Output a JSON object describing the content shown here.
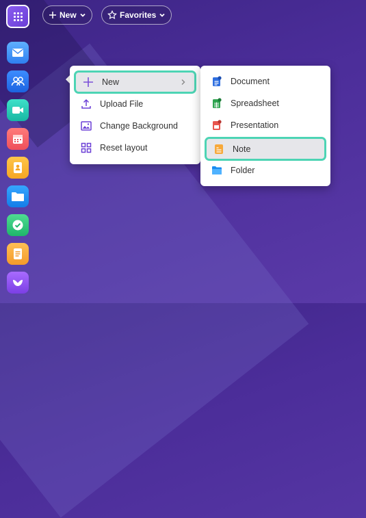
{
  "topbar": {
    "new_label": "New",
    "favorites_label": "Favorites"
  },
  "dock": [
    "mail-app",
    "contacts-app",
    "video-app",
    "calendar-app",
    "address-book-app",
    "files-app",
    "tasks-app",
    "notes-app",
    "other-app"
  ],
  "context_menu": {
    "items": [
      {
        "label": "New",
        "icon": "plus-icon",
        "highlighted": true
      },
      {
        "label": "Upload File",
        "icon": "upload-icon"
      },
      {
        "label": "Change Background",
        "icon": "image-icon"
      },
      {
        "label": "Reset layout",
        "icon": "layout-icon"
      }
    ]
  },
  "submenu": {
    "items": [
      {
        "label": "Document",
        "icon": "document-icon"
      },
      {
        "label": "Spreadsheet",
        "icon": "spreadsheet-icon"
      },
      {
        "label": "Presentation",
        "icon": "presentation-icon"
      },
      {
        "label": "Note",
        "icon": "note-icon",
        "highlighted": true
      },
      {
        "label": "Folder",
        "icon": "folder-icon"
      }
    ]
  },
  "colors": {
    "highlight_border": "#4dd4b4",
    "accent_purple": "#6a3fd6"
  }
}
